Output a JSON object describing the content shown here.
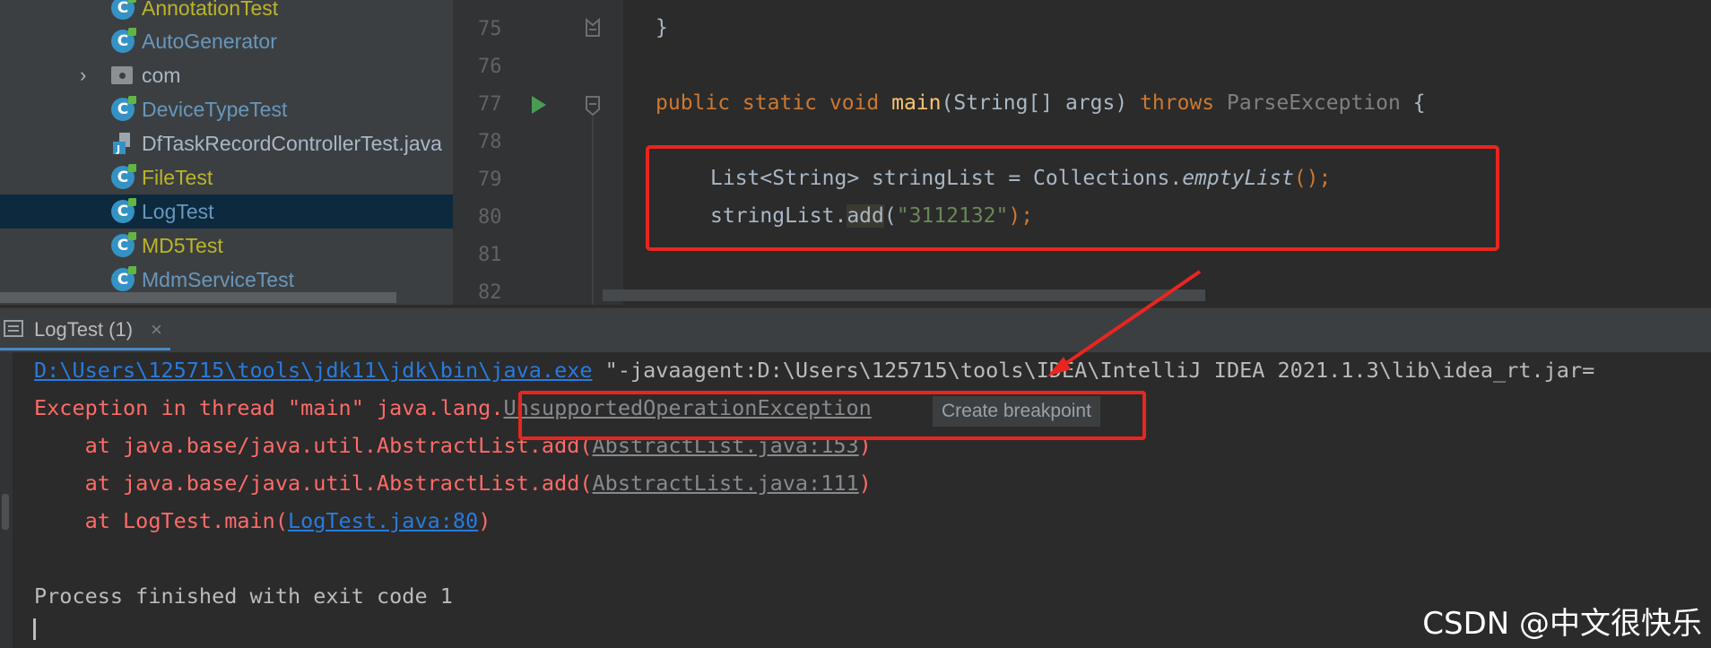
{
  "project_tree": {
    "items": [
      {
        "label": "AnnotationTest",
        "icon": "java-class-icon",
        "color": "#bbb529"
      },
      {
        "label": "AutoGenerator",
        "icon": "java-class-icon",
        "color": "#6897bb"
      },
      {
        "label": "com",
        "icon": "package-icon",
        "color": "#a9b7c6",
        "expandable": true
      },
      {
        "label": "DeviceTypeTest",
        "icon": "java-class-icon",
        "color": "#6897bb"
      },
      {
        "label": "DfTaskRecordControllerTest.java",
        "icon": "java-file-icon",
        "color": "#a9b7c6"
      },
      {
        "label": "FileTest",
        "icon": "java-class-icon",
        "color": "#bbb529"
      },
      {
        "label": "LogTest",
        "icon": "java-class-icon",
        "color": "#6897bb",
        "selected": true
      },
      {
        "label": "MD5Test",
        "icon": "java-class-icon",
        "color": "#bbb529"
      },
      {
        "label": "MdmServiceTest",
        "icon": "java-class-icon",
        "color": "#6897bb"
      }
    ]
  },
  "editor": {
    "line_numbers": [
      "75",
      "76",
      "77",
      "78",
      "79",
      "80",
      "81",
      "82"
    ],
    "lines": {
      "l75": "}",
      "l77_kw1": "public static void ",
      "l77_fn": "main",
      "l77_mid": "(String[] args) ",
      "l77_throws": "throws ",
      "l77_exc": "ParseException",
      "l77_end": " {",
      "l79_a": "List<String> stringList = Collections.",
      "l79_it": "emptyList",
      "l79_b": "();",
      "l80_a": "stringList.",
      "l80_add": "add",
      "l80_b": "(",
      "l80_str": "\"3112132\"",
      "l80_c": ");"
    }
  },
  "run_panel": {
    "tab_label": "LogTest (1)",
    "close_glyph": "×",
    "lines": {
      "cmd_link": "D:\\Users\\125715\\tools\\jdk11\\jdk\\bin\\java.exe",
      "cmd_rest": " \"-javaagent:D:\\Users\\125715\\tools\\IDEA\\IntelliJ IDEA 2021.1.3\\lib\\idea_rt.jar=",
      "exc_prefix": "Exception in thread \"main\" java.lang.",
      "exc_class": "UnsupportedOperationException",
      "create_breakpoint": "Create breakpoint",
      "at1_prefix": "    at java.base/java.util.AbstractList.add(",
      "at1_link": "AbstractList.java:153",
      "at1_suffix": ")",
      "at2_prefix": "    at java.base/java.util.AbstractList.add(",
      "at2_link": "AbstractList.java:111",
      "at2_suffix": ")",
      "at3_prefix": "    at LogTest.main(",
      "at3_link": "LogTest.java:80",
      "at3_suffix": ")",
      "finished": "Process finished with exit code 1"
    }
  },
  "watermark": "CSDN @中文很快乐",
  "colors": {
    "annotation_box": "#e8261f",
    "error_text": "#ff6b68",
    "link": "#287bde",
    "selection": "#0d293e"
  }
}
